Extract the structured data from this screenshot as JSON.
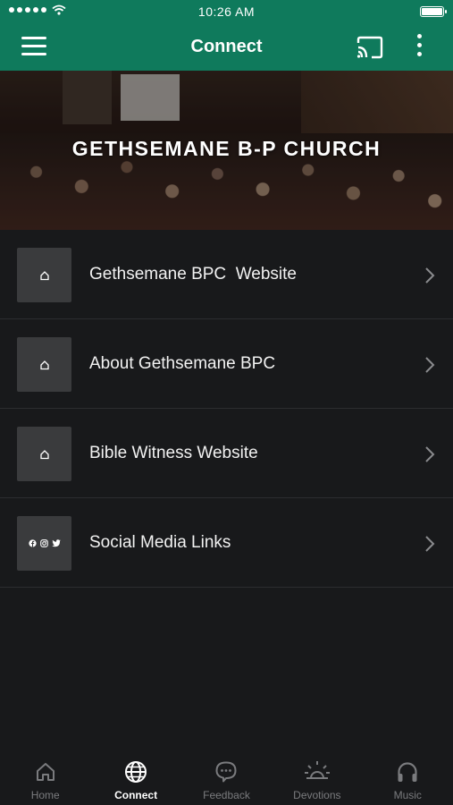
{
  "status_bar": {
    "time": "10:26 AM"
  },
  "app_bar": {
    "title": "Connect"
  },
  "hero": {
    "title": "GETHSEMANE B-P CHURCH"
  },
  "list": {
    "items": [
      {
        "label": "Gethsemane BPC  Website",
        "icon": "home-icon"
      },
      {
        "label": "About Gethsemane BPC",
        "icon": "home-icon"
      },
      {
        "label": "Bible Witness Website",
        "icon": "home-icon"
      },
      {
        "label": "Social Media Links",
        "icon": "social-icons"
      }
    ]
  },
  "tabs": [
    {
      "label": "Home",
      "icon": "home-icon",
      "active": false
    },
    {
      "label": "Connect",
      "icon": "globe-icon",
      "active": true
    },
    {
      "label": "Feedback",
      "icon": "chat-bubble-icon",
      "active": false
    },
    {
      "label": "Devotions",
      "icon": "sun-icon",
      "active": false
    },
    {
      "label": "Music",
      "icon": "headphones-icon",
      "active": false
    }
  ],
  "colors": {
    "accent": "#0f7a5c",
    "background": "#18191b",
    "tab_inactive": "#7a7b7e"
  }
}
